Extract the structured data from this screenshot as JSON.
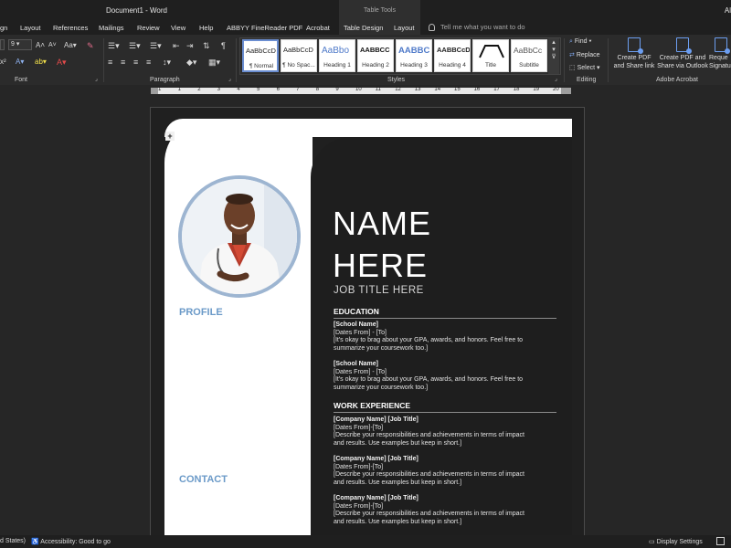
{
  "titlebar": {
    "doc_title": "Document1  -  Word",
    "context_tab": "Table Tools",
    "account": "Al"
  },
  "tabs": [
    "gn",
    "Layout",
    "References",
    "Mailings",
    "Review",
    "View",
    "Help",
    "ABBYY FineReader PDF",
    "Acrobat",
    "Table Design",
    "Layout"
  ],
  "tell_me": "Tell me what you want to do",
  "ribbon": {
    "font_size": "9",
    "groups": {
      "font": "Font",
      "paragraph": "Paragraph",
      "styles": "Styles",
      "editing": "Editing",
      "acrobat": "Adobe Acrobat"
    },
    "styles": [
      {
        "sample": "AaBbCcD",
        "name": "¶ Normal"
      },
      {
        "sample": "AaBbCcD",
        "name": "¶ No Spac..."
      },
      {
        "sample": "AaBbo",
        "name": "Heading 1"
      },
      {
        "sample": "AABBCC",
        "name": "Heading 2"
      },
      {
        "sample": "AABBC",
        "name": "Heading 3"
      },
      {
        "sample": "AABBCcD",
        "name": "Heading 4"
      },
      {
        "sample": "",
        "name": "Title"
      },
      {
        "sample": "AaBbCc",
        "name": "Subtitle"
      }
    ],
    "editing": {
      "find": "Find",
      "replace": "Replace",
      "select": "Select"
    },
    "acrobat": {
      "create_share_link": "Create PDF and Share link",
      "create_share_outlook": "Create PDF and Share via Outlook",
      "request_signatures": "Reque Signatu"
    }
  },
  "ruler": {
    "labels": [
      "1",
      "1",
      "2",
      "3",
      "4",
      "5",
      "6",
      "7",
      "8",
      "9",
      "10",
      "11",
      "12",
      "13",
      "14",
      "15",
      "16",
      "17",
      "18",
      "19",
      "20"
    ]
  },
  "resume": {
    "name_line1": "NAME",
    "name_line2": "HERE",
    "job_title": "JOB TITLE HERE",
    "profile_heading": "PROFILE",
    "contact_heading": "CONTACT",
    "education_heading": "EDUCATION",
    "work_heading": "WORK EXPERIENCE",
    "education": [
      {
        "school": "[School Name]",
        "dates": "[Dates From] - [To]",
        "desc1": "[It's okay to brag about your GPA, awards, and honors. Feel free to",
        "desc2": "summarize your coursework too.]"
      },
      {
        "school": "[School Name]",
        "dates": "[Dates From] - [To]",
        "desc1": "[It's okay to brag about your GPA, awards, and honors. Feel free to",
        "desc2": "summarize your coursework too.]"
      }
    ],
    "work": [
      {
        "company": "[Company Name]  [Job Title]",
        "dates": "[Dates From]-[To]",
        "desc1": "[Describe your responsibilities and achievements in terms of impact",
        "desc2": "and results. Use examples but keep in short.]"
      },
      {
        "company": "[Company Name]  [Job Title]",
        "dates": "[Dates From]-[To]",
        "desc1": "[Describe your responsibilities and achievements in terms of impact",
        "desc2": "and results. Use examples but keep in short.]"
      },
      {
        "company": "[Company Name]  [Job Title]",
        "dates": "[Dates From]-[To]",
        "desc1": "[Describe your responsibilities and achievements in terms of impact",
        "desc2": "and results. Use examples but keep in short.]"
      }
    ]
  },
  "statusbar": {
    "language": "d States)",
    "accessibility": "Accessibility: Good to go",
    "display_settings": "Display Settings"
  },
  "colors": {
    "accent_blue": "#6b9ac8",
    "photo_ring": "#9db5d1",
    "page_dark": "#1e1e1e"
  }
}
